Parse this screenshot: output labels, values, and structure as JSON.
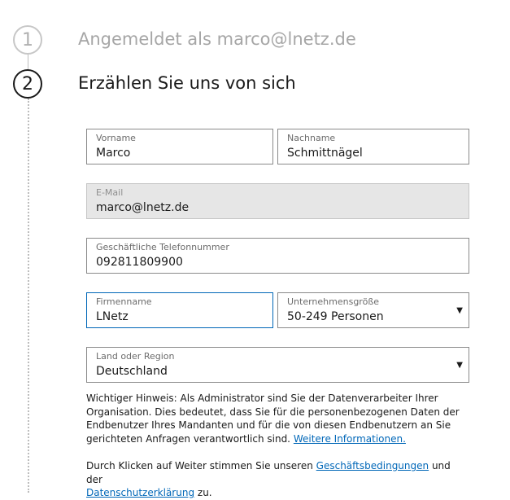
{
  "steps": [
    {
      "number": "1",
      "title": "Angemeldet als marco@lnetz.de"
    },
    {
      "number": "2",
      "title": "Erzählen Sie uns von sich"
    }
  ],
  "form": {
    "first_name": {
      "label": "Vorname",
      "value": "Marco"
    },
    "last_name": {
      "label": "Nachname",
      "value": "Schmittnägel"
    },
    "email": {
      "label": "E-Mail",
      "value": "marco@lnetz.de"
    },
    "phone": {
      "label": "Geschäftliche Telefonnummer",
      "value": "092811809900"
    },
    "company": {
      "label": "Firmenname",
      "value": "LNetz"
    },
    "company_size": {
      "label": "Unternehmensgröße",
      "value": "50-249 Personen"
    },
    "country": {
      "label": "Land oder Region",
      "value": "Deutschland"
    }
  },
  "notice": {
    "text": "Wichtiger Hinweis: Als Administrator sind Sie der Datenverarbeiter Ihrer Organisation. Dies bedeutet, dass Sie für die personenbezogenen Daten der Endbenutzer Ihres Mandanten und für die von diesen Endbenutzern an Sie gerichteten Anfragen verantwortlich sind.",
    "link": "Weitere Informationen."
  },
  "terms": {
    "prefix": "Durch Klicken auf Weiter stimmen Sie unseren",
    "terms_link": "Geschäftsbedingungen",
    "middle": "und der",
    "privacy_link": "Datenschutzerklärung",
    "suffix": "zu."
  },
  "icons": {
    "dropdown": "chevron-down-icon"
  }
}
